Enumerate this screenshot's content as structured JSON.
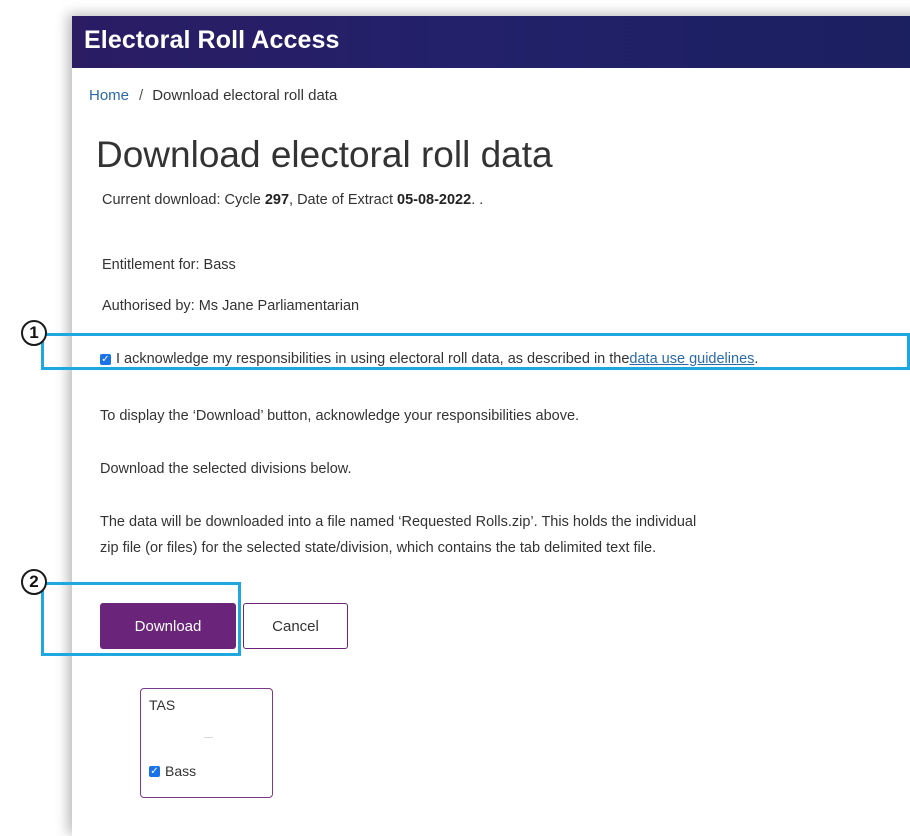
{
  "app": {
    "title": "Electoral Roll Access"
  },
  "breadcrumb": {
    "home": "Home",
    "separator": "/",
    "current": "Download electoral roll data"
  },
  "page": {
    "title": "Download electoral roll data"
  },
  "download_info": {
    "prefix": "Current download: Cycle ",
    "cycle": "297",
    "mid": ", Date of Extract ",
    "date": "05-08-2022",
    "suffix": ". ."
  },
  "entitlement": "Entitlement for: Bass",
  "authorised": "Authorised by: Ms Jane Parliamentarian",
  "acknowledge": {
    "checked": true,
    "text": "I acknowledge my responsibilities in using electoral roll data, as described in the ",
    "link": "data use guidelines",
    "end": "."
  },
  "instructions": {
    "display": "To display the ‘Download’ button, acknowledge your responsibilities above.",
    "selected": "Download the selected divisions below.",
    "file_line1": "The data will be downloaded into a file named ‘Requested Rolls.zip’. This holds the individual",
    "file_line2": "zip file (or files) for the selected state/division, which contains the tab delimited text file."
  },
  "buttons": {
    "download": "Download",
    "cancel": "Cancel"
  },
  "state": {
    "name": "TAS",
    "divisions": [
      {
        "label": "Bass",
        "checked": true
      }
    ]
  },
  "callouts": {
    "one": "1",
    "two": "2"
  },
  "colors": {
    "topbar": "#22216a",
    "primary_button": "#6a2479",
    "link": "#2a6aa8",
    "callout": "#1fa8e0"
  }
}
